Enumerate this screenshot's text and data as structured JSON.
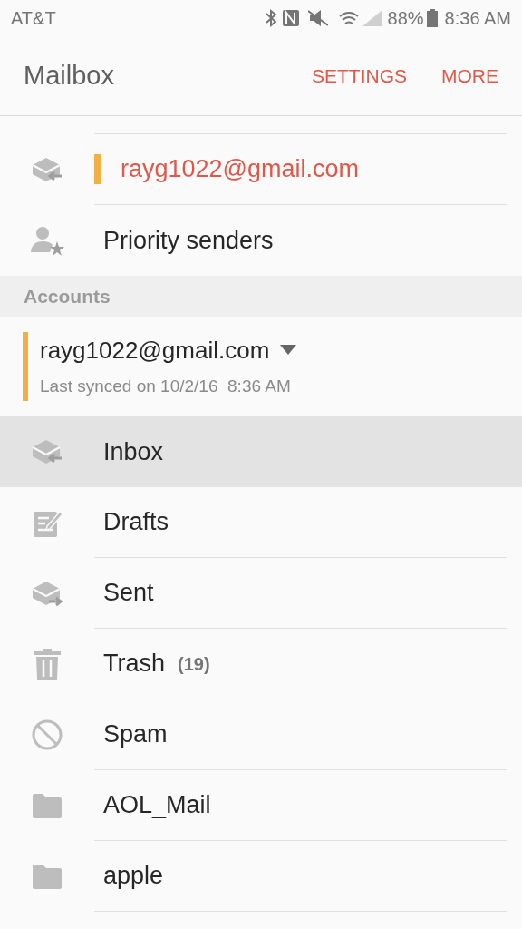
{
  "status_bar": {
    "carrier": "AT&T",
    "battery": "88%",
    "time": "8:36 AM"
  },
  "app_bar": {
    "title": "Mailbox",
    "actions": [
      "SETTINGS",
      "MORE"
    ]
  },
  "quick_items": [
    {
      "kind": "account",
      "label": "rayg1022@gmail.com",
      "color": "#f0b046"
    },
    {
      "kind": "priority",
      "label": "Priority senders"
    }
  ],
  "accounts_header": "Accounts",
  "account": {
    "email": "rayg1022@gmail.com",
    "synced": "Last synced on 10/2/16  8:36 AM",
    "color": "#f0b046"
  },
  "folders": [
    {
      "kind": "inbox",
      "label": "Inbox",
      "selected": true
    },
    {
      "kind": "drafts",
      "label": "Drafts",
      "selected": false
    },
    {
      "kind": "sent",
      "label": "Sent",
      "selected": false
    },
    {
      "kind": "trash",
      "label": "Trash",
      "count": "(19)",
      "selected": false
    },
    {
      "kind": "spam",
      "label": "Spam",
      "selected": false
    },
    {
      "kind": "folder",
      "label": "AOL_Mail",
      "selected": false
    },
    {
      "kind": "folder",
      "label": "apple",
      "selected": false
    }
  ]
}
